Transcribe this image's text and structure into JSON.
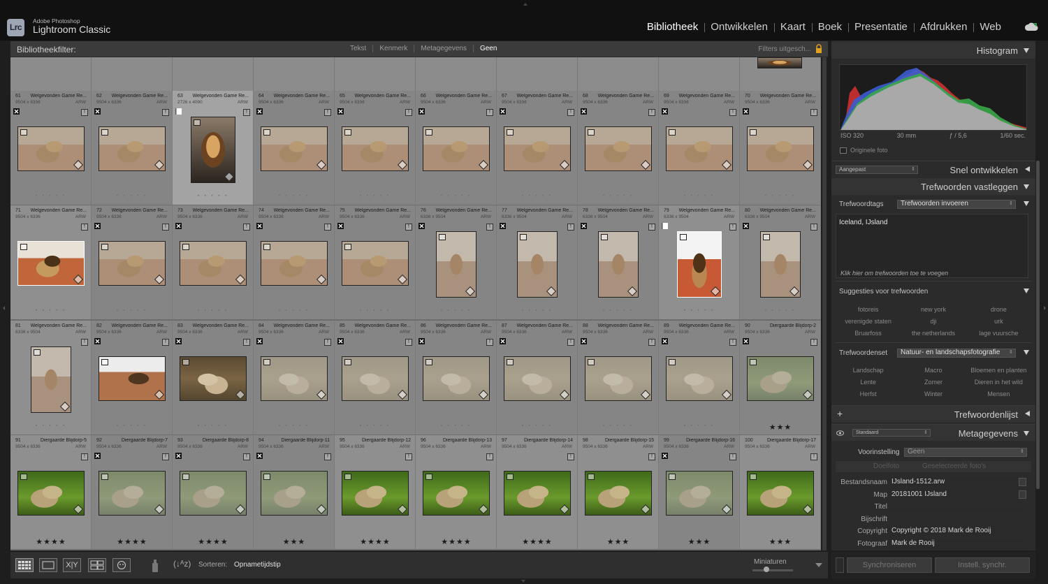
{
  "app": {
    "logo": "Lrc",
    "vendor": "Adobe Photoshop",
    "name": "Lightroom Classic"
  },
  "modules": [
    "Bibliotheek",
    "Ontwikkelen",
    "Kaart",
    "Boek",
    "Presentatie",
    "Afdrukken",
    "Web"
  ],
  "active_module": "Bibliotheek",
  "filterbar": {
    "label": "Bibliotheekfilter:",
    "options": [
      "Tekst",
      "Kenmerk",
      "Metagegevens",
      "Geen"
    ],
    "active": "Geen",
    "right": "Filters uitgesch..."
  },
  "grid": {
    "rows": [
      {
        "cells": [
          {
            "n": "61",
            "name": "Welgevonden Game Re...",
            "dim": "9504 x 6336",
            "ext": "ARW",
            "flag": "reject",
            "thumb": "lion-grey",
            "stars": ""
          },
          {
            "n": "62",
            "name": "Welgevonden Game Re...",
            "dim": "9504 x 6336",
            "ext": "ARW",
            "flag": "reject",
            "thumb": "lion-grey",
            "stars": ""
          },
          {
            "n": "63",
            "name": "Welgevonden Game Re...",
            "dim": "2726 x 4090",
            "ext": "ARW",
            "flag": "pick",
            "thumb": "lion-portrait",
            "stars": "",
            "sel": true,
            "portrait": true
          },
          {
            "n": "64",
            "name": "Welgevonden Game Re...",
            "dim": "9504 x 6336",
            "ext": "ARW",
            "flag": "reject",
            "thumb": "lion-grey",
            "stars": ""
          },
          {
            "n": "65",
            "name": "Welgevonden Game Re...",
            "dim": "9504 x 6336",
            "ext": "ARW",
            "flag": "reject",
            "thumb": "lion-grey",
            "stars": ""
          },
          {
            "n": "66",
            "name": "Welgevonden Game Re...",
            "dim": "9504 x 6336",
            "ext": "ARW",
            "flag": "reject",
            "thumb": "lion-grey",
            "stars": ""
          },
          {
            "n": "67",
            "name": "Welgevonden Game Re...",
            "dim": "9504 x 6336",
            "ext": "ARW",
            "flag": "reject",
            "thumb": "lion-grey",
            "stars": ""
          },
          {
            "n": "68",
            "name": "Welgevonden Game Re...",
            "dim": "9504 x 6336",
            "ext": "ARW",
            "flag": "reject",
            "thumb": "lion-grey",
            "stars": ""
          },
          {
            "n": "69",
            "name": "Welgevonden Game Re...",
            "dim": "9504 x 6336",
            "ext": "ARW",
            "flag": "reject",
            "thumb": "lion-grey",
            "stars": ""
          },
          {
            "n": "70",
            "name": "Welgevonden Game Re...",
            "dim": "9504 x 6336",
            "ext": "ARW",
            "flag": "reject",
            "thumb": "lion-grey",
            "stars": ""
          }
        ]
      },
      {
        "cells": [
          {
            "n": "71",
            "name": "Welgevonden Game Re...",
            "dim": "9504 x 6336",
            "ext": "ARW",
            "flag": "none",
            "thumb": "lion-bright",
            "stars": ""
          },
          {
            "n": "72",
            "name": "Welgevonden Game Re...",
            "dim": "9504 x 6336",
            "ext": "ARW",
            "flag": "reject",
            "thumb": "lion-grey",
            "stars": ""
          },
          {
            "n": "73",
            "name": "Welgevonden Game Re...",
            "dim": "9504 x 6336",
            "ext": "ARW",
            "flag": "reject",
            "thumb": "lion-grey",
            "stars": ""
          },
          {
            "n": "74",
            "name": "Welgevonden Game Re...",
            "dim": "9504 x 6336",
            "ext": "ARW",
            "flag": "reject",
            "thumb": "lion-grey",
            "stars": ""
          },
          {
            "n": "75",
            "name": "Welgevonden Game Re...",
            "dim": "9504 x 6336",
            "ext": "ARW",
            "flag": "reject",
            "thumb": "lion-grey",
            "stars": ""
          },
          {
            "n": "76",
            "name": "Welgevonden Game Re...",
            "dim": "6336 x 9504",
            "ext": "ARW",
            "flag": "reject",
            "thumb": "lion-tall-grey",
            "stars": "",
            "portrait": true
          },
          {
            "n": "77",
            "name": "Welgevonden Game Re...",
            "dim": "6336 x 9504",
            "ext": "ARW",
            "flag": "reject",
            "thumb": "lion-tall-grey",
            "stars": "",
            "portrait": true
          },
          {
            "n": "78",
            "name": "Welgevonden Game Re...",
            "dim": "6336 x 9504",
            "ext": "ARW",
            "flag": "reject",
            "thumb": "lion-tall-grey",
            "stars": "",
            "portrait": true
          },
          {
            "n": "79",
            "name": "Welgevonden Game Re...",
            "dim": "6336 x 9504",
            "ext": "ARW",
            "flag": "pick",
            "thumb": "lion-tall-bright",
            "stars": "",
            "portrait": true
          },
          {
            "n": "80",
            "name": "Welgevonden Game Re...",
            "dim": "6336 x 9504",
            "ext": "ARW",
            "flag": "reject",
            "thumb": "lion-tall-grey",
            "stars": "",
            "portrait": true
          }
        ]
      },
      {
        "cells": [
          {
            "n": "81",
            "name": "Welgevonden Game Re...",
            "dim": "6336 x 9504",
            "ext": "ARW",
            "flag": "none",
            "thumb": "lion-tall-grey",
            "stars": "",
            "portrait": true
          },
          {
            "n": "82",
            "name": "Welgevonden Game Re...",
            "dim": "9504 x 6336",
            "ext": "ARW",
            "flag": "reject",
            "thumb": "lion-yawn",
            "stars": ""
          },
          {
            "n": "83",
            "name": "Welgevonden Game Re...",
            "dim": "9504 x 6336",
            "ext": "ARW",
            "flag": "reject",
            "thumb": "lioness",
            "stars": ""
          },
          {
            "n": "84",
            "name": "Welgevonden Game Re...",
            "dim": "9504 x 6336",
            "ext": "ARW",
            "flag": "reject",
            "thumb": "lioness-grey",
            "stars": ""
          },
          {
            "n": "85",
            "name": "Welgevonden Game Re...",
            "dim": "9504 x 6336",
            "ext": "ARW",
            "flag": "reject",
            "thumb": "lioness-grey",
            "stars": ""
          },
          {
            "n": "86",
            "name": "Welgevonden Game Re...",
            "dim": "9504 x 6336",
            "ext": "ARW",
            "flag": "reject",
            "thumb": "lioness-grey",
            "stars": ""
          },
          {
            "n": "87",
            "name": "Welgevonden Game Re...",
            "dim": "9504 x 6336",
            "ext": "ARW",
            "flag": "reject",
            "thumb": "lioness-grey",
            "stars": ""
          },
          {
            "n": "88",
            "name": "Welgevonden Game Re...",
            "dim": "9504 x 6336",
            "ext": "ARW",
            "flag": "reject",
            "thumb": "lioness-grey",
            "stars": ""
          },
          {
            "n": "89",
            "name": "Welgevonden Game Re...",
            "dim": "9504 x 6336",
            "ext": "ARW",
            "flag": "reject",
            "thumb": "lioness-grey",
            "stars": ""
          },
          {
            "n": "90",
            "name": "Diergaarde Blijdorp-2",
            "dim": "9504 x 6336",
            "ext": "ARW",
            "flag": "reject",
            "thumb": "lion-grass-grey",
            "stars": "★★★"
          }
        ]
      },
      {
        "cells": [
          {
            "n": "91",
            "name": "Diergaarde Blijdorp-5",
            "dim": "9504 x 6336",
            "ext": "ARW",
            "flag": "none",
            "thumb": "lion-grass",
            "stars": "★★★★"
          },
          {
            "n": "92",
            "name": "Diergaarde Blijdorp-7",
            "dim": "9504 x 6336",
            "ext": "ARW",
            "flag": "reject",
            "thumb": "lion-grass-grey",
            "stars": "★★★★"
          },
          {
            "n": "93",
            "name": "Diergaarde Blijdorp-8",
            "dim": "9504 x 6336",
            "ext": "ARW",
            "flag": "reject",
            "thumb": "lion-grass-grey",
            "stars": "★★★★"
          },
          {
            "n": "94",
            "name": "Diergaarde Blijdorp-11",
            "dim": "9504 x 6336",
            "ext": "ARW",
            "flag": "reject",
            "thumb": "lion-grass-grey",
            "stars": "★★★"
          },
          {
            "n": "95",
            "name": "Diergaarde Blijdorp-12",
            "dim": "9504 x 6336",
            "ext": "ARW",
            "flag": "none",
            "thumb": "lion-grass",
            "stars": "★★★★"
          },
          {
            "n": "96",
            "name": "Diergaarde Blijdorp-13",
            "dim": "9504 x 6336",
            "ext": "ARW",
            "flag": "none",
            "thumb": "lion-grass",
            "stars": "★★★★"
          },
          {
            "n": "97",
            "name": "Diergaarde Blijdorp-14",
            "dim": "9504 x 6336",
            "ext": "ARW",
            "flag": "none",
            "thumb": "lion-grass",
            "stars": "★★★★"
          },
          {
            "n": "98",
            "name": "Diergaarde Blijdorp-15",
            "dim": "9504 x 6336",
            "ext": "ARW",
            "flag": "none",
            "thumb": "lion-grass",
            "stars": "★★★"
          },
          {
            "n": "99",
            "name": "Diergaarde Blijdorp-16",
            "dim": "9504 x 6336",
            "ext": "ARW",
            "flag": "reject",
            "thumb": "lion-grass-grey",
            "stars": "★★★"
          },
          {
            "n": "100",
            "name": "Diergaarde Blijdorp-17",
            "dim": "9504 x 6336",
            "ext": "ARW",
            "flag": "none",
            "thumb": "lion-grass",
            "stars": "★★★"
          }
        ]
      }
    ]
  },
  "histogram": {
    "title": "Histogram",
    "iso": "ISO 320",
    "focal": "30 mm",
    "aperture": "ƒ / 5,6",
    "shutter": "1/60 sec.",
    "original_label": "Originele foto"
  },
  "quick_develop": {
    "title": "Snel ontwikkelen",
    "preset": "Aangepast"
  },
  "keywording": {
    "title": "Trefwoorden vastleggen",
    "tags_label": "Trefwoordtags",
    "tags_select": "Trefwoorden invoeren",
    "keywords": "Iceland, IJsland",
    "click_hint": "Klik hier om trefwoorden toe te voegen",
    "suggestions_title": "Suggesties voor trefwoorden",
    "suggestions": [
      "fotoreis",
      "new york",
      "drone",
      "verenigde staten",
      "dji",
      "urk",
      "Bruarfoss",
      "the netherlands",
      "lage vuursche"
    ],
    "set_label": "Trefwoordenset",
    "set_value": "Natuur- en landschapsfotografie",
    "set_keywords": [
      "Landschap",
      "Macro",
      "Bloemen en planten",
      "Lente",
      "Zomer",
      "Dieren in het wild",
      "Herfst",
      "Winter",
      "Mensen"
    ]
  },
  "keyword_list": {
    "title": "Trefwoordenlijst",
    "plus": "+"
  },
  "metadata": {
    "title": "Metagegevens",
    "view": "Standaard",
    "preset_label": "Voorinstelling",
    "preset_value": "Geen",
    "tabs": [
      "Doelfoto",
      "Geselecteerde foto's"
    ],
    "fields": [
      {
        "label": "Bestandsnaam",
        "value": "IJsland-1512.arw"
      },
      {
        "label": "Map",
        "value": "20181001 IJsland"
      },
      {
        "label": "Titel",
        "value": ""
      },
      {
        "label": "Bijschrift",
        "value": ""
      },
      {
        "label": "Copyright",
        "value": "Copyright © 2018 Mark de Rooij"
      },
      {
        "label": "Fotograaf",
        "value": "Mark de Rooij"
      }
    ]
  },
  "toolbar": {
    "sort_label": "Sorteren:",
    "sort_value": "Opnametijdstip",
    "thumbs_label": "Miniaturen",
    "thumb_size": 0.35
  },
  "sync": {
    "sync_label": "Synchroniseren",
    "sync_settings_label": "Instell. synchr."
  },
  "colors": {
    "accent": "#ffffff",
    "grid_bg": "#8f8f8f",
    "panel_bg": "#2b2b2b"
  }
}
